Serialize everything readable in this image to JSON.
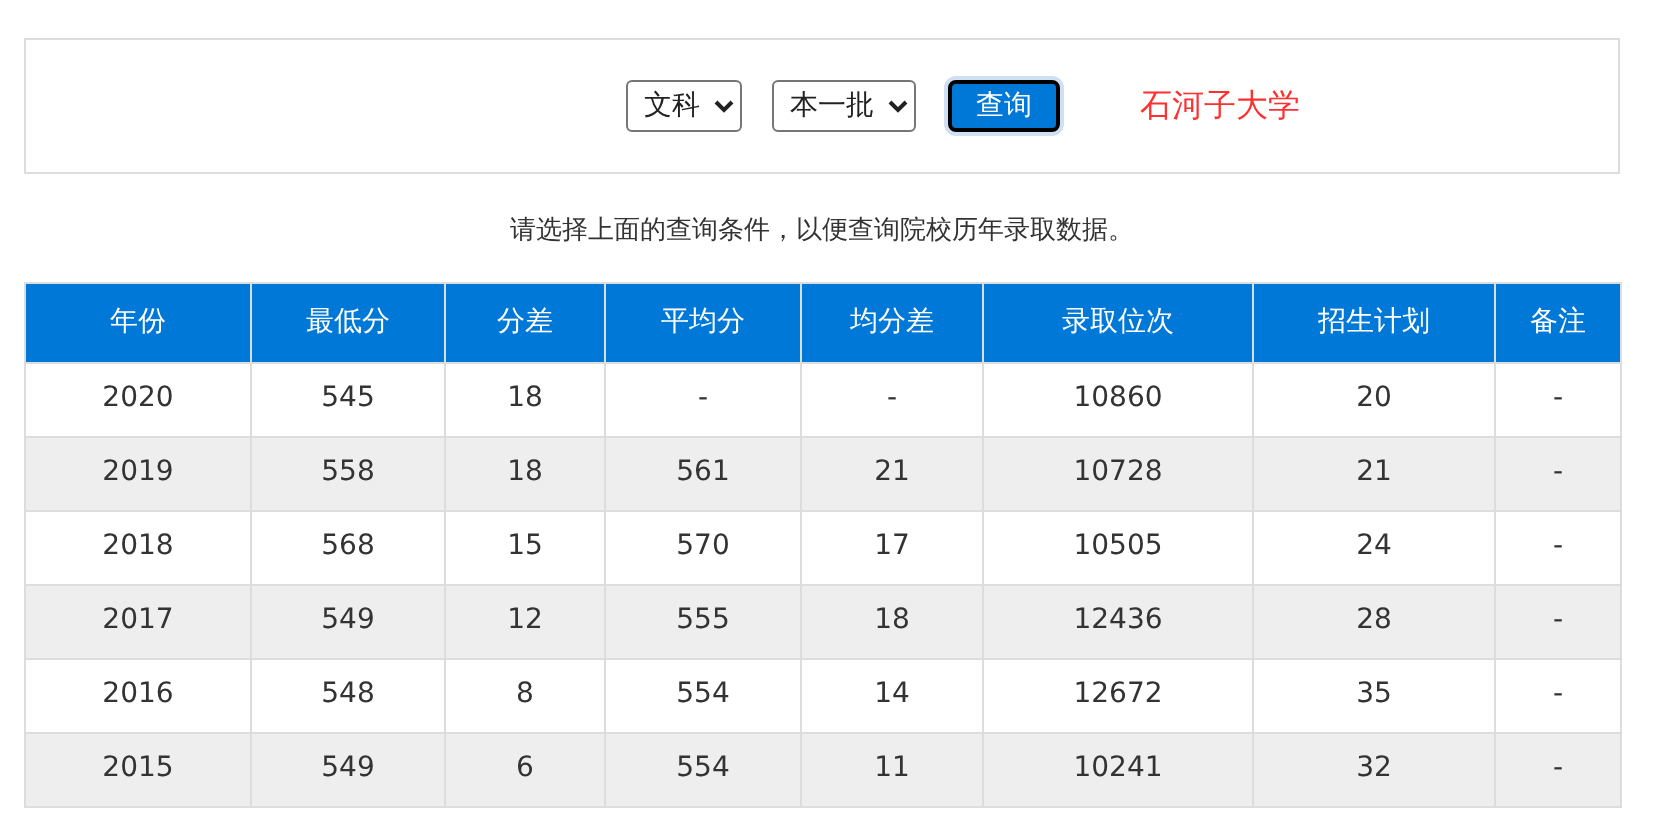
{
  "filters": {
    "subject": {
      "value": "文科"
    },
    "batch": {
      "value": "本一批"
    },
    "query_button": "查询",
    "school": "石河子大学"
  },
  "hint": "请选择上面的查询条件，以便查询院校历年录取数据。",
  "table": {
    "columns": [
      "年份",
      "最低分",
      "分差",
      "平均分",
      "均分差",
      "录取位次",
      "招生计划",
      "备注"
    ],
    "rows": [
      [
        "2020",
        "545",
        "18",
        "-",
        "-",
        "10860",
        "20",
        "-"
      ],
      [
        "2019",
        "558",
        "18",
        "561",
        "21",
        "10728",
        "21",
        "-"
      ],
      [
        "2018",
        "568",
        "15",
        "570",
        "17",
        "10505",
        "24",
        "-"
      ],
      [
        "2017",
        "549",
        "12",
        "555",
        "18",
        "12436",
        "28",
        "-"
      ],
      [
        "2016",
        "548",
        "8",
        "554",
        "14",
        "12672",
        "35",
        "-"
      ],
      [
        "2015",
        "549",
        "6",
        "554",
        "11",
        "10241",
        "32",
        "-"
      ]
    ]
  }
}
